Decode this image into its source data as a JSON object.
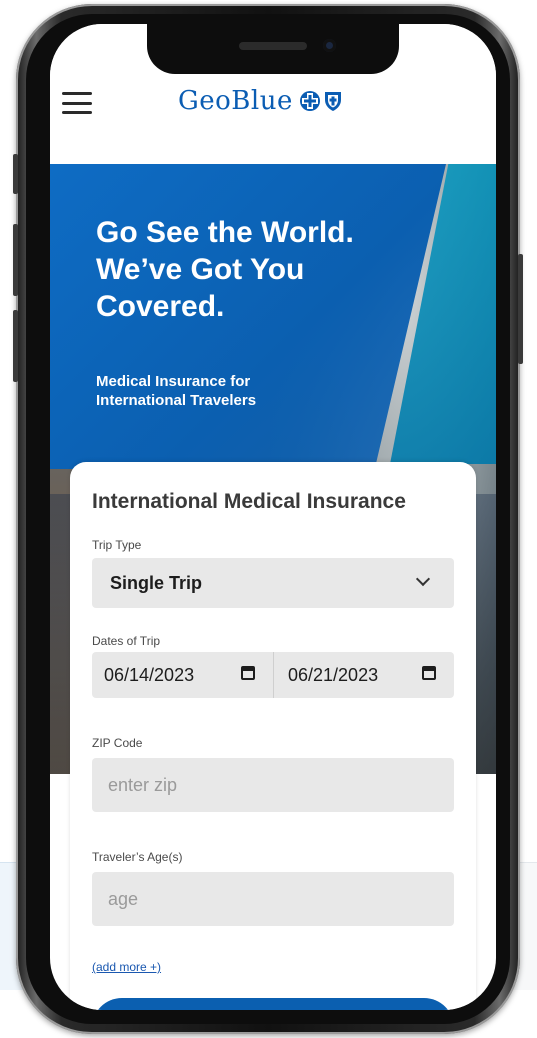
{
  "brand": {
    "name": "GeoBlue",
    "colors": {
      "primary": "#0b5fb0",
      "logo_text": "#0b5db3",
      "field_bg": "#e8e8e8",
      "link": "#1a58b0"
    },
    "logo_icons": [
      "blue-cross-icon",
      "blue-shield-icon"
    ]
  },
  "header": {
    "menu_icon": "hamburger-menu-icon"
  },
  "hero": {
    "title": "Go See the World. We’ve Got You Covered.",
    "subtitle": "Medical Insurance for International Travelers"
  },
  "form": {
    "title": "International Medical Insurance",
    "trip_type": {
      "label": "Trip Type",
      "value": "Single Trip"
    },
    "dates": {
      "label": "Dates of Trip",
      "start": "06/14/2023",
      "end": "06/21/2023"
    },
    "zip": {
      "label": "ZIP Code",
      "placeholder": "enter zip"
    },
    "ages": {
      "label": "Traveler’s Age(s)",
      "placeholder": "age"
    },
    "add_more": "(add more +)"
  }
}
